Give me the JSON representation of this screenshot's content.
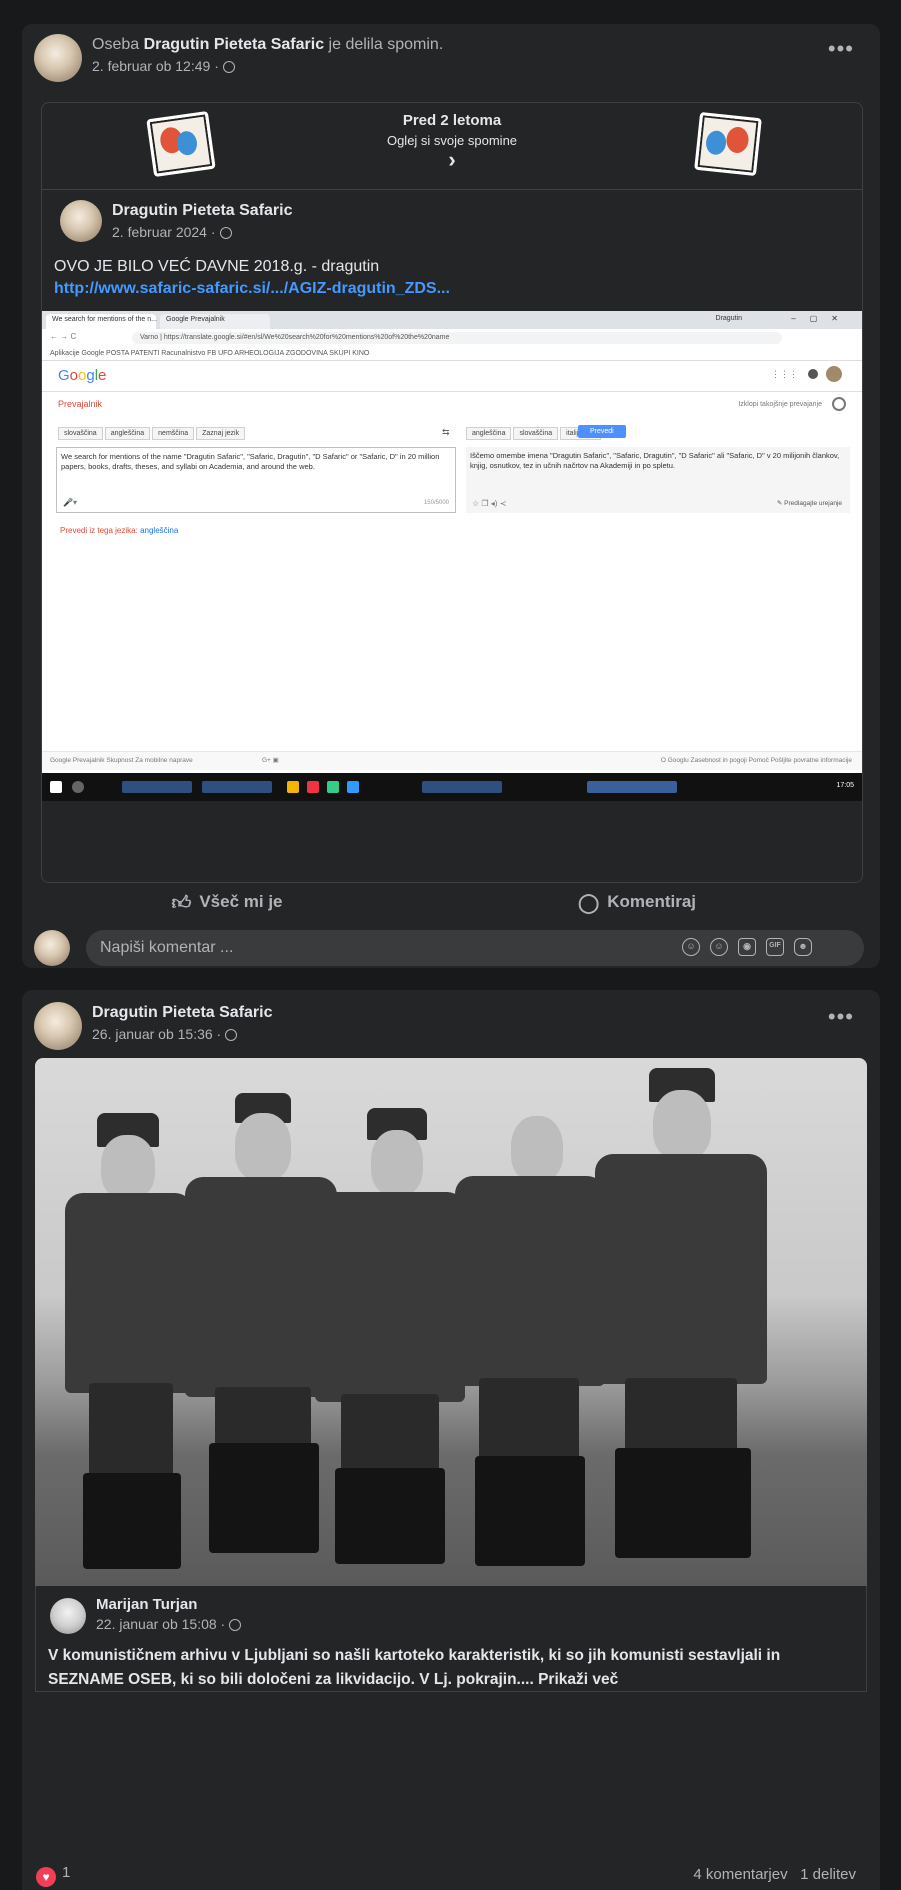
{
  "post1": {
    "header_prefix": "Oseba",
    "author": "Dragutin Pieteta Safaric",
    "header_suffix": "je delila spomin.",
    "timestamp": "2. februar ob 12:49 ·",
    "memory": {
      "title": "Pred 2 letoma",
      "subtitle": "Oglej si svoje spomine",
      "chevron": "›"
    },
    "shared": {
      "author": "Dragutin Pieteta Safaric",
      "date": "2. februar 2024 ·",
      "text": "OVO JE BILO VEĆ DAVNE 2018.g. - dragutin",
      "link": "http://www.safaric-safaric.si/.../AGIZ-dragutin_ZDS..."
    },
    "embed": {
      "tab1": "We search for mentions of the n...",
      "tab2": "Google Prevajalnik",
      "window_user": "Dragutin",
      "url": "Varno | https://translate.google.si/#en/sl/We%20search%20for%20mentions%20of%20the%20name",
      "bookmarks": "Aplikacije   Google   POSTA   PATENTI   Racunalnistvo   FB   UFO   ARHEOLOGIJA   ZGODOVINA   SKUPI   KINO",
      "logo": "Google",
      "page_title": "Prevajalnik",
      "right_link": "Izklopi takojšnje prevajanje",
      "src_langs": [
        "slovaščina",
        "angleščina",
        "nemščina",
        "Zaznaj jezik"
      ],
      "dst_langs": [
        "angleščina",
        "slovaščina",
        "italijanski"
      ],
      "translate_button": "Prevedi",
      "source_text": "We search for mentions of the name \"Dragutin Safaric\", \"Safaric, Dragutin\", \"D Safaric\" or \"Safaric, D\" in 20 million papers, books, drafts, theses, and syllabi on Academia, and around the web.",
      "target_text": "Iščemo omembe imena \"Dragutin Safaric\", \"Safaric, Dragutin\", \"D Safaric\" ali \"Safaric, D\" v 20 milijonih člankov, knjig, osnutkov, tez in učnih načrtov na Akademiji in po spletu.",
      "char_count": "150/5000",
      "suggest_edit": "Predlagajte urejanje",
      "translate_in": "Prevedi iz tega jezika:",
      "translate_in_lang": "angleščina",
      "footer_left": "Google Prevajalnik   Skupnost   Za mobilne naprave",
      "footer_right": "O Googlu   Zasebnost in pogoji   Pomoč   Pošljite povratne informacije",
      "time": "17:05"
    },
    "actions": {
      "like": "Všeč mi je",
      "comment": "Komentiraj"
    },
    "comment_placeholder": "Napiši komentar ...",
    "comment_icons": [
      "avatar-sticker-icon",
      "emoji-icon",
      "camera-icon",
      "gif-icon",
      "sticker-icon"
    ]
  },
  "post2": {
    "author": "Dragutin Pieteta Safaric",
    "timestamp": "26. januar ob 15:36 ·",
    "shared": {
      "author": "Marijan Turjan",
      "date": "22. januar ob 15:08 ·",
      "text": "V komunističnem arhivu v Ljubljani so našli kartoteko karakteristik, ki so jih komunisti sestavljali in SEZNAME OSEB, ki so bili določeni za likvidacijo. V Lj. pokrajin....",
      "see_more": "Prikaži več"
    },
    "reactions_count": "1",
    "comments_count": "4 komentarjev",
    "shares_count": "1 delitev"
  },
  "colors": {
    "background": "#18191a",
    "card": "#242526",
    "link": "#4599ff",
    "muted": "#b0b3b8",
    "heart": "#f33e58"
  }
}
